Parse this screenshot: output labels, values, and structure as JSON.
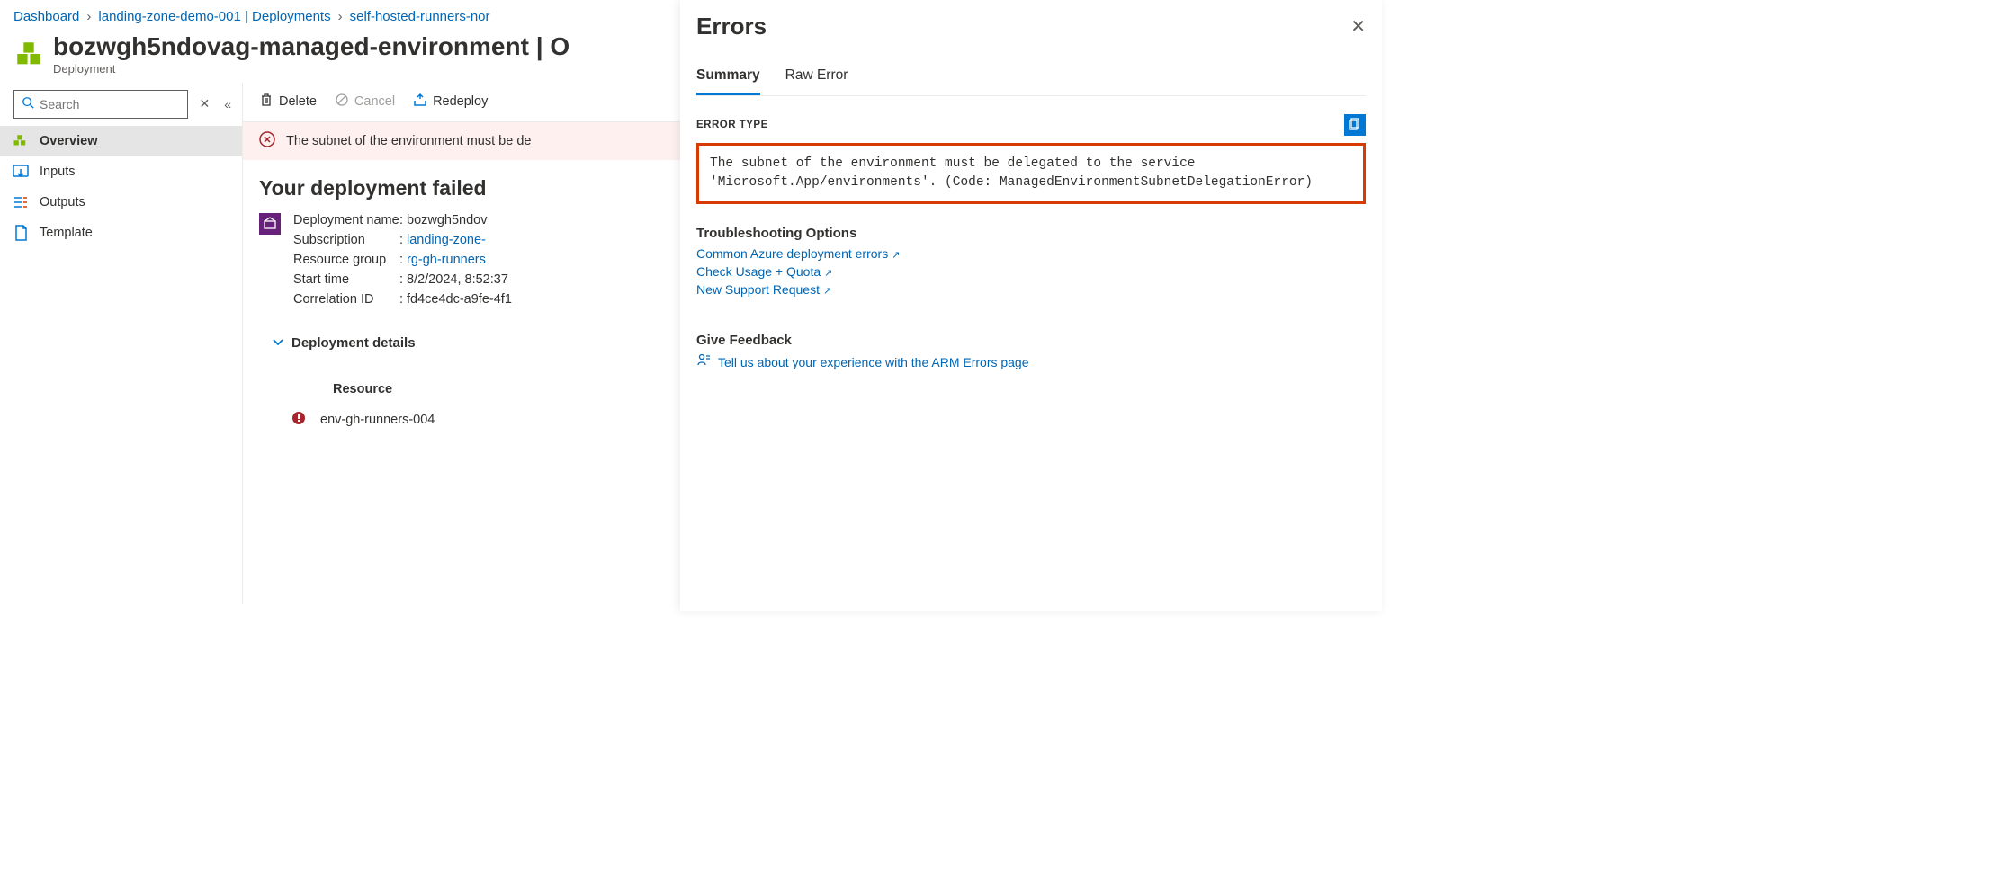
{
  "breadcrumb": {
    "items": [
      "Dashboard",
      "landing-zone-demo-001 | Deployments",
      "self-hosted-runners-nor"
    ]
  },
  "page": {
    "title": "bozwgh5ndovag-managed-environment | O",
    "subtitle": "Deployment"
  },
  "search": {
    "placeholder": "Search"
  },
  "sidebar": {
    "items": [
      {
        "label": "Overview"
      },
      {
        "label": "Inputs"
      },
      {
        "label": "Outputs"
      },
      {
        "label": "Template"
      }
    ]
  },
  "commands": {
    "delete": "Delete",
    "cancel": "Cancel",
    "redeploy": "Redeploy"
  },
  "banner": {
    "text": "The subnet of the environment must be de"
  },
  "fail": {
    "heading": "Your deployment failed",
    "meta": {
      "deployment_name_label": "Deployment name",
      "deployment_name": "bozwgh5ndov",
      "subscription_label": "Subscription",
      "subscription": "landing-zone-",
      "resource_group_label": "Resource group",
      "resource_group": "rg-gh-runners",
      "start_time_label": "Start time",
      "start_time": "8/2/2024, 8:52:37",
      "correlation_id_label": "Correlation ID",
      "correlation_id": "fd4ce4dc-a9fe-4f1"
    },
    "details_toggle": "Deployment details",
    "table": {
      "header_resource": "Resource",
      "row_resource": "env-gh-runners-004"
    }
  },
  "flyout": {
    "title": "Errors",
    "tabs": {
      "summary": "Summary",
      "raw": "Raw Error"
    },
    "error_type_label": "ERROR TYPE",
    "error_message": "The subnet of the environment must be delegated to the service 'Microsoft.App/environments'. (Code: ManagedEnvironmentSubnetDelegationError)",
    "troubleshooting_header": "Troubleshooting Options",
    "links": {
      "common": "Common Azure deployment errors",
      "quota": "Check Usage + Quota",
      "support": "New Support Request"
    },
    "feedback_header": "Give Feedback",
    "feedback_link": "Tell us about your experience with the ARM Errors page"
  }
}
